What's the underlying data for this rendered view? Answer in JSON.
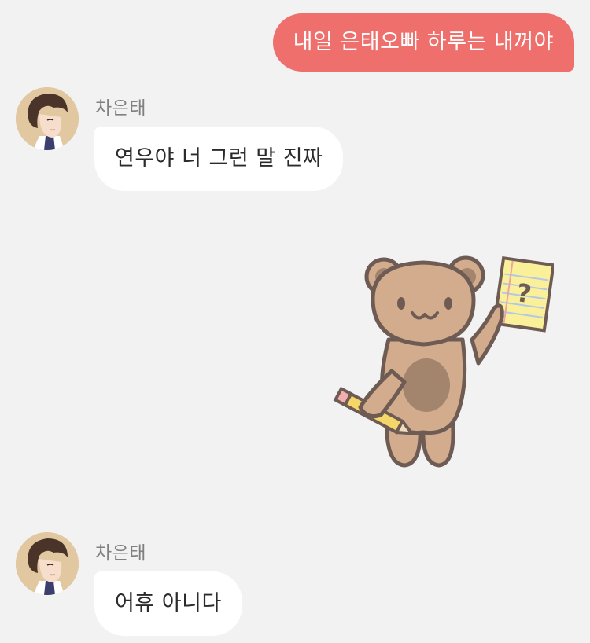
{
  "messages": [
    {
      "from": "me",
      "text": "내일 은태오빠 하루는 내꺼야"
    },
    {
      "from": "them",
      "sender": "차은태",
      "text": "연우야 너 그런 말 진짜"
    },
    {
      "from": "them",
      "sticker": "bear-holding-question-note-sticker"
    },
    {
      "from": "them",
      "sender": "차은태",
      "text": "어휴 아니다"
    }
  ],
  "colors": {
    "background": "#f2f2f2",
    "my_bubble": "#ee6f6b",
    "their_bubble": "#ffffff",
    "sender_name": "#808080"
  }
}
